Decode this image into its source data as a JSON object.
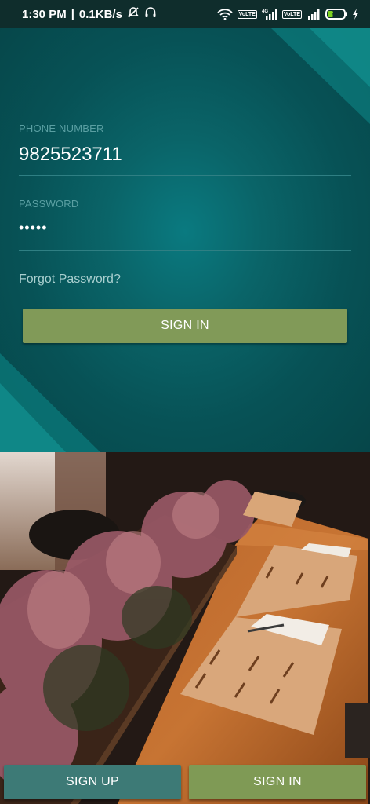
{
  "status_bar": {
    "time": "1:30 PM",
    "net_speed": "0.1KB/s",
    "battery": "40",
    "battery_level": 0.4,
    "lte_badge": "VoLTE",
    "network_type": "4G",
    "icons": [
      "alarm-off-icon",
      "headphones-icon",
      "wifi-icon",
      "volte-icon",
      "signal-icon",
      "battery-icon",
      "charging-icon"
    ]
  },
  "login": {
    "phone_label": "PHONE NUMBER",
    "phone_value": "9825523711",
    "password_label": "PASSWORD",
    "password_value": "•••••",
    "forgot_password": "Forgot Password?",
    "sign_in_button": "SIGN IN"
  },
  "bottom_bar": {
    "sign_up_button": "SIGN UP",
    "sign_in_button": "SIGN IN"
  },
  "colors": {
    "panel_teal": "#075256",
    "accent_olive": "#819a58",
    "signup_teal": "#3d7a76"
  }
}
